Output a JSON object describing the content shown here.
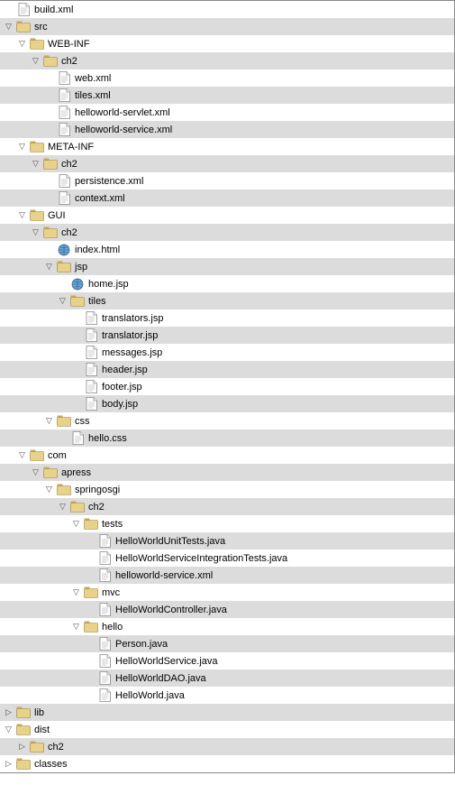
{
  "tree": [
    {
      "depth": 0,
      "toggle": "none",
      "icon": "file",
      "label": "build.xml",
      "interact": true
    },
    {
      "depth": 0,
      "toggle": "open",
      "icon": "folder",
      "label": "src",
      "interact": true
    },
    {
      "depth": 1,
      "toggle": "open",
      "icon": "folder",
      "label": "WEB-INF",
      "interact": true
    },
    {
      "depth": 2,
      "toggle": "open",
      "icon": "folder",
      "label": "ch2",
      "interact": true
    },
    {
      "depth": 3,
      "toggle": "none",
      "icon": "file",
      "label": "web.xml",
      "interact": true
    },
    {
      "depth": 3,
      "toggle": "none",
      "icon": "file",
      "label": "tiles.xml",
      "interact": true
    },
    {
      "depth": 3,
      "toggle": "none",
      "icon": "file",
      "label": "helloworld-servlet.xml",
      "interact": true
    },
    {
      "depth": 3,
      "toggle": "none",
      "icon": "file",
      "label": "helloworld-service.xml",
      "interact": true
    },
    {
      "depth": 1,
      "toggle": "open",
      "icon": "folder",
      "label": "META-INF",
      "interact": true
    },
    {
      "depth": 2,
      "toggle": "open",
      "icon": "folder",
      "label": "ch2",
      "interact": true
    },
    {
      "depth": 3,
      "toggle": "none",
      "icon": "file",
      "label": "persistence.xml",
      "interact": true
    },
    {
      "depth": 3,
      "toggle": "none",
      "icon": "file",
      "label": "context.xml",
      "interact": true
    },
    {
      "depth": 1,
      "toggle": "open",
      "icon": "folder",
      "label": "GUI",
      "interact": true
    },
    {
      "depth": 2,
      "toggle": "open",
      "icon": "folder",
      "label": "ch2",
      "interact": true
    },
    {
      "depth": 3,
      "toggle": "none",
      "icon": "earth",
      "label": "index.html",
      "interact": true
    },
    {
      "depth": 3,
      "toggle": "open",
      "icon": "folder",
      "label": "jsp",
      "interact": true
    },
    {
      "depth": 4,
      "toggle": "none",
      "icon": "earth",
      "label": "home.jsp",
      "interact": true
    },
    {
      "depth": 4,
      "toggle": "open",
      "icon": "folder",
      "label": "tiles",
      "interact": true
    },
    {
      "depth": 5,
      "toggle": "none",
      "icon": "file",
      "label": "translators.jsp",
      "interact": true
    },
    {
      "depth": 5,
      "toggle": "none",
      "icon": "file",
      "label": "translator.jsp",
      "interact": true
    },
    {
      "depth": 5,
      "toggle": "none",
      "icon": "file",
      "label": "messages.jsp",
      "interact": true
    },
    {
      "depth": 5,
      "toggle": "none",
      "icon": "file",
      "label": "header.jsp",
      "interact": true
    },
    {
      "depth": 5,
      "toggle": "none",
      "icon": "file",
      "label": "footer.jsp",
      "interact": true
    },
    {
      "depth": 5,
      "toggle": "none",
      "icon": "file",
      "label": "body.jsp",
      "interact": true
    },
    {
      "depth": 3,
      "toggle": "open",
      "icon": "folder",
      "label": "css",
      "interact": true
    },
    {
      "depth": 4,
      "toggle": "none",
      "icon": "file",
      "label": "hello.css",
      "interact": true
    },
    {
      "depth": 1,
      "toggle": "open",
      "icon": "folder",
      "label": "com",
      "interact": true
    },
    {
      "depth": 2,
      "toggle": "open",
      "icon": "folder",
      "label": "apress",
      "interact": true
    },
    {
      "depth": 3,
      "toggle": "open",
      "icon": "folder",
      "label": "springosgi",
      "interact": true
    },
    {
      "depth": 4,
      "toggle": "open",
      "icon": "folder",
      "label": "ch2",
      "interact": true
    },
    {
      "depth": 5,
      "toggle": "open",
      "icon": "folder",
      "label": "tests",
      "interact": true
    },
    {
      "depth": 6,
      "toggle": "none",
      "icon": "file",
      "label": "HelloWorldUnitTests.java",
      "interact": true
    },
    {
      "depth": 6,
      "toggle": "none",
      "icon": "file",
      "label": "HelloWorldServiceIntegrationTests.java",
      "interact": true
    },
    {
      "depth": 6,
      "toggle": "none",
      "icon": "file",
      "label": "helloworld-service.xml",
      "interact": true
    },
    {
      "depth": 5,
      "toggle": "open",
      "icon": "folder",
      "label": "mvc",
      "interact": true
    },
    {
      "depth": 6,
      "toggle": "none",
      "icon": "file",
      "label": "HelloWorldController.java",
      "interact": true
    },
    {
      "depth": 5,
      "toggle": "open",
      "icon": "folder",
      "label": "hello",
      "interact": true
    },
    {
      "depth": 6,
      "toggle": "none",
      "icon": "file",
      "label": "Person.java",
      "interact": true
    },
    {
      "depth": 6,
      "toggle": "none",
      "icon": "file",
      "label": "HelloWorldService.java",
      "interact": true
    },
    {
      "depth": 6,
      "toggle": "none",
      "icon": "file",
      "label": "HelloWorldDAO.java",
      "interact": true
    },
    {
      "depth": 6,
      "toggle": "none",
      "icon": "file",
      "label": "HelloWorld.java",
      "interact": true
    },
    {
      "depth": 0,
      "toggle": "closed",
      "icon": "folder",
      "label": "lib",
      "interact": true
    },
    {
      "depth": 0,
      "toggle": "open",
      "icon": "folder",
      "label": "dist",
      "interact": true
    },
    {
      "depth": 1,
      "toggle": "closed",
      "icon": "folder",
      "label": "ch2",
      "interact": true
    },
    {
      "depth": 0,
      "toggle": "closed",
      "icon": "folder",
      "label": "classes",
      "interact": true
    }
  ]
}
